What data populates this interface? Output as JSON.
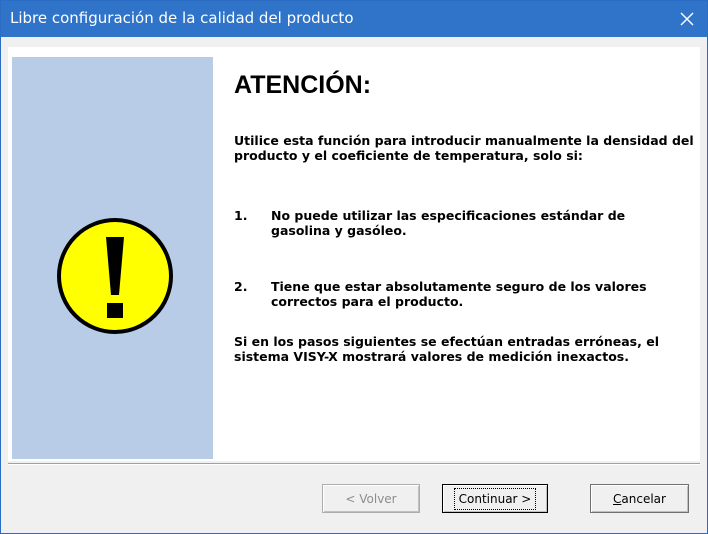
{
  "window": {
    "title": "Libre configuración de la calidad del producto",
    "close_symbol": "✕"
  },
  "icons": {
    "warning": "exclamation-warning-icon",
    "close": "close-icon"
  },
  "colors": {
    "titlebar": "#2f74c8",
    "side_panel": "#b8cce8",
    "warning_fill": "#ffff00"
  },
  "content": {
    "heading": "ATENCIÓN:",
    "intro": "Utilice esta función para introducir manualmente la densidad del producto y el coeficiente de temperatura, solo si:",
    "items": [
      {
        "number": "1.",
        "text": "No puede utilizar las especificaciones estándar de gasolina y gasóleo."
      },
      {
        "number": "2.",
        "text": "Tiene que estar absolutamente seguro de los valores correctos para el producto."
      }
    ],
    "warning": "Si en los pasos siguientes se efectúan entradas erróneas, el sistema VISY-X mostrará valores de medición inexactos."
  },
  "buttons": {
    "back": "< Volver",
    "next": "Continuar >",
    "cancel_first": "C",
    "cancel_rest": "ancelar"
  }
}
